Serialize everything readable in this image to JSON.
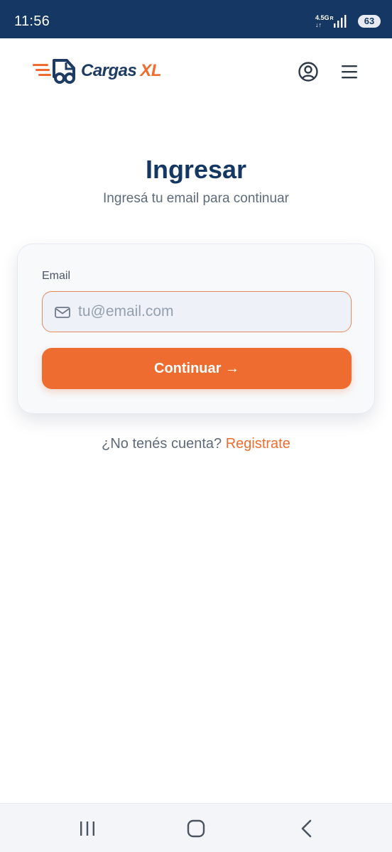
{
  "status_bar": {
    "time": "11:56",
    "network": "4.5G",
    "network_flag": "R",
    "arrows": "↓↑",
    "battery": "63"
  },
  "header": {
    "logo_main": "Cargas",
    "logo_accent": "XL",
    "user_icon": "user-circle-icon",
    "menu_icon": "hamburger-menu-icon"
  },
  "login": {
    "title": "Ingresar",
    "subtitle": "Ingresá tu email para continuar",
    "email_label": "Email",
    "email_placeholder": "tu@email.com",
    "email_value": "",
    "email_icon": "mail-icon",
    "continue_label": "Continuar →",
    "signup_prompt": "¿No tenés cuenta?",
    "signup_link": "Registrate"
  },
  "colors": {
    "brand_navy": "#143863",
    "brand_orange": "#ee6c2f",
    "status_bar": "#143863"
  },
  "nav_bar": {
    "recents_icon": "recent-apps-icon",
    "home_icon": "home-icon",
    "back_icon": "back-icon"
  }
}
